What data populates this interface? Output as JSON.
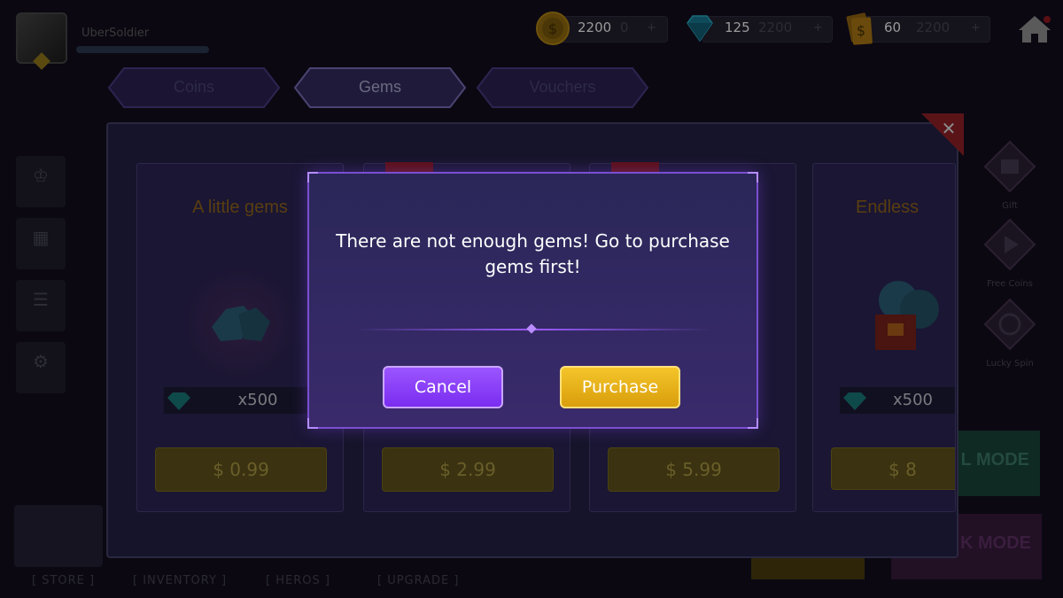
{
  "player": {
    "username": "UberSoldier"
  },
  "currencies": {
    "coins": {
      "value": "2200",
      "ghost": "0",
      "icon": "coin-icon"
    },
    "gems": {
      "value": "125",
      "ghost": "2200",
      "icon": "gem-icon"
    },
    "vouchers": {
      "value": "60",
      "ghost": "2200",
      "icon": "voucher-icon"
    }
  },
  "tabs": [
    {
      "label": "Coins",
      "active": false
    },
    {
      "label": "Gems",
      "active": true
    },
    {
      "label": "Vouchers",
      "active": false
    }
  ],
  "cards": [
    {
      "title": "A little gems",
      "qty": "x500",
      "price": "$ 0.99"
    },
    {
      "title": "",
      "qty": "",
      "price": "$ 2.99"
    },
    {
      "title": "",
      "qty": "",
      "price": "$ 5.99"
    },
    {
      "title": "Endless",
      "qty": "x500",
      "price": "$ 8"
    }
  ],
  "right_menu": [
    {
      "label": "Gift"
    },
    {
      "label": "Free Coins"
    },
    {
      "label": "Lucky Spin"
    }
  ],
  "modes": {
    "mode1": "L MODE",
    "mode2": "K MODE"
  },
  "bottom_nav": [
    "[ STORE ]",
    "[ INVENTORY ]",
    "[ HEROS ]",
    "[ UPGRADE ]"
  ],
  "modal": {
    "message_line1": "There are not enough gems! Go to purchase",
    "message_line2": "gems first!",
    "cancel_label": "Cancel",
    "purchase_label": "Purchase"
  },
  "colors": {
    "accent_purple": "#7a2df0",
    "accent_gold": "#d99e0c",
    "modal_border": "#7a4fd0"
  }
}
